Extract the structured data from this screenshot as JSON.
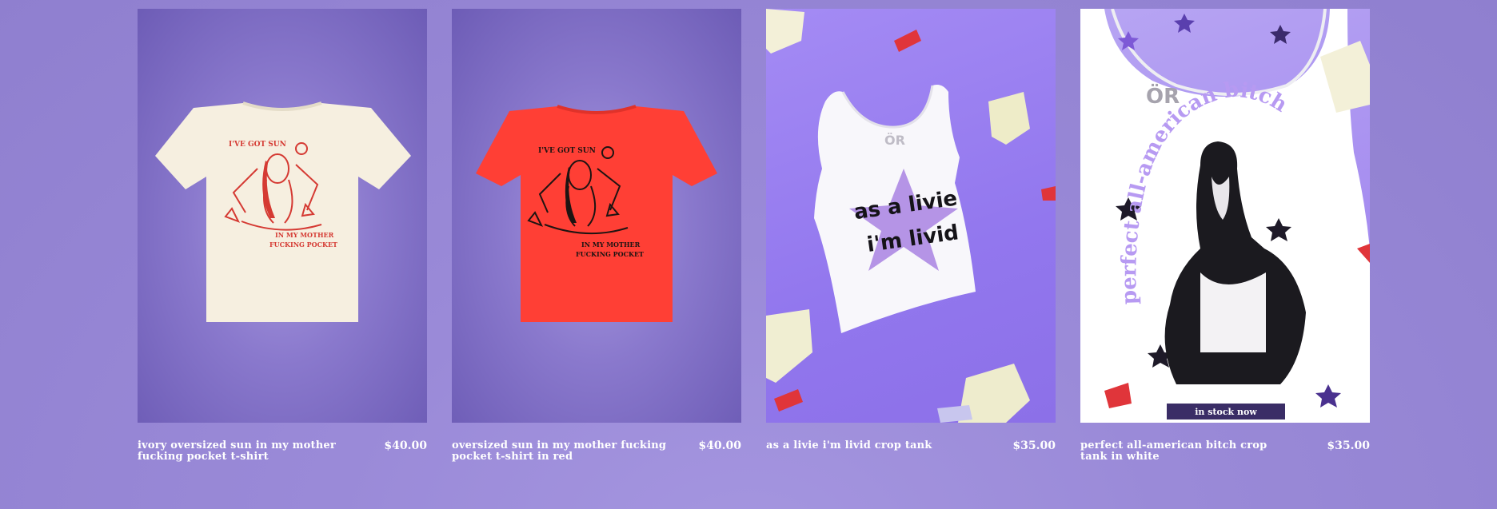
{
  "products": [
    {
      "name": "ivory oversized sun in my mother fucking pocket t-shirt",
      "price": "$40.00",
      "image_icon": "tshirt-ivory-icon",
      "shirt_color": "#f6efe0",
      "print_color": "#d53a33"
    },
    {
      "name": "oversized sun in my mother fucking pocket t-shirt in red",
      "price": "$40.00",
      "image_icon": "tshirt-red-icon",
      "shirt_color": "#ff3f35",
      "print_color": "#1e1412"
    },
    {
      "name": "as a livie i'm livid crop tank",
      "price": "$35.00",
      "image_icon": "crop-tank-icon",
      "tank_text_line1": "as a livie",
      "tank_text_line2": "i'm livid"
    },
    {
      "name": "perfect all-american bitch crop tank in white",
      "price": "$35.00",
      "image_icon": "crop-tank-white-icon",
      "badge": "in stock now",
      "tank_arc_text": "perfect all-american bitch"
    }
  ],
  "colors": {
    "page_bg": "#9a8ad8",
    "text": "#ffffff",
    "badge_bg": "#3a2d66",
    "lavender_print": "#b79af2"
  }
}
